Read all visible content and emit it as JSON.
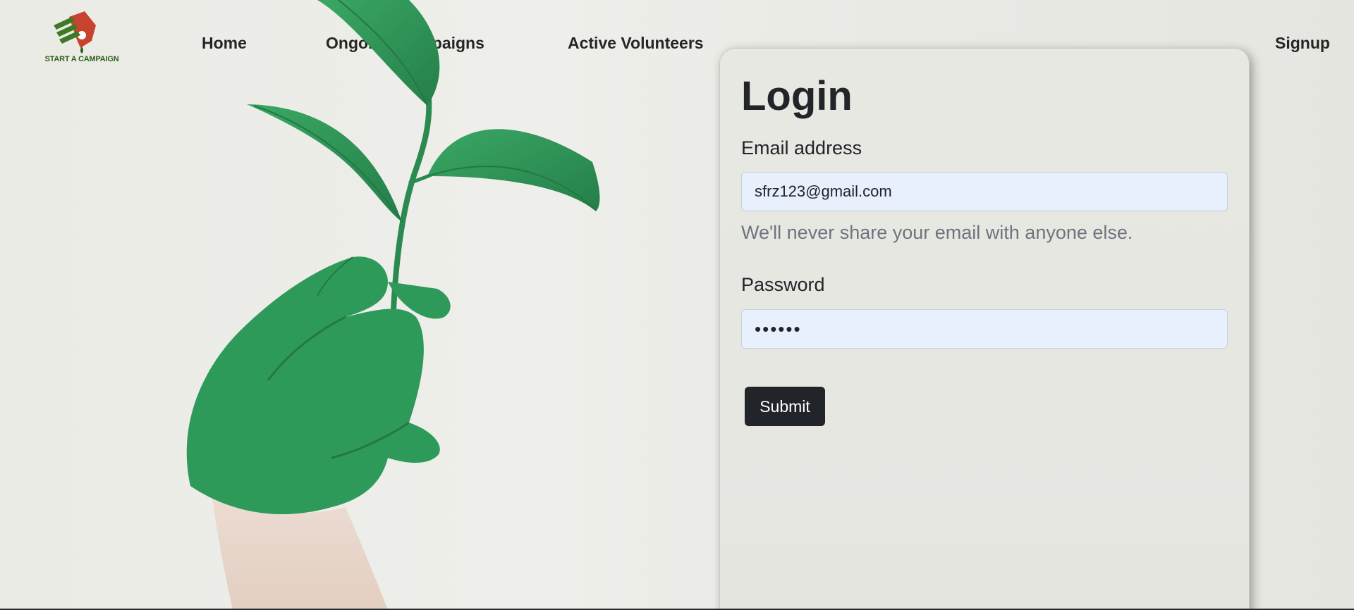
{
  "logo": {
    "text": "START A CAMPAIGN"
  },
  "nav": {
    "home": "Home",
    "campaigns": "Ongoing Campaigns",
    "volunteers": "Active Volunteers",
    "signup": "Signup"
  },
  "login": {
    "title": "Login",
    "email_label": "Email address",
    "email_value": "sfrz123@gmail.com",
    "email_help": "We'll never share your email with anyone else.",
    "password_label": "Password",
    "password_value": "••••••",
    "submit_label": "Submit"
  },
  "colors": {
    "plant_green": "#2e9a5a",
    "button_dark": "#212529",
    "input_autofill": "#e8f0fe"
  }
}
